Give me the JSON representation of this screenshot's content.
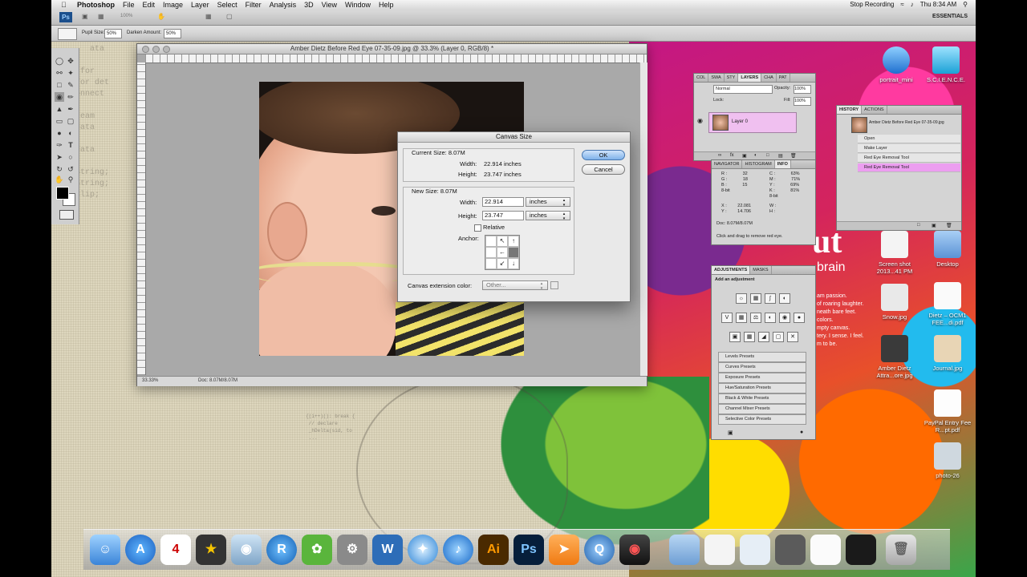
{
  "menubar": {
    "app_name": "Photoshop",
    "menus": [
      "File",
      "Edit",
      "Image",
      "Layer",
      "Select",
      "Filter",
      "Analysis",
      "3D",
      "View",
      "Window",
      "Help"
    ],
    "status_recording": "Stop Recording",
    "clock": "Thu 8:34 AM"
  },
  "appbar": {
    "ps_badge": "Ps",
    "zoom": "100%",
    "workspace": "ESSENTIALS"
  },
  "options": {
    "pupil_size_label": "Pupil Size:",
    "pupil_size_value": "50%",
    "darken_amount_label": "Darken Amount:",
    "darken_amount_value": "50%"
  },
  "document": {
    "title": "Amber Dietz Before Red Eye 07-35-09.jpg @ 33.3% (Layer 0, RGB/8) *",
    "zoom": "33.33%",
    "doc_size": "Doc: 8.07M/8.07M"
  },
  "canvas_dialog": {
    "title": "Canvas Size",
    "current_size_label": "Current Size: 8.07M",
    "current_width_label": "Width:",
    "current_width_value": "22.914 inches",
    "current_height_label": "Height:",
    "current_height_value": "23.747 inches",
    "new_size_label": "New Size: 8.07M",
    "width_label": "Width:",
    "width_value": "22.914",
    "width_unit": "inches",
    "height_label": "Height:",
    "height_value": "23.747",
    "height_unit": "inches",
    "relative_label": "Relative",
    "anchor_label": "Anchor:",
    "ext_color_label": "Canvas extension color:",
    "ext_color_value": "Other...",
    "ok_label": "OK",
    "cancel_label": "Cancel"
  },
  "layers_panel": {
    "tabs": [
      "COL",
      "SWA",
      "STY",
      "LAYERS",
      "CHA",
      "PAT"
    ],
    "blend_mode": "Normal",
    "opacity_label": "Opacity:",
    "opacity_value": "100%",
    "lock_label": "Lock:",
    "fill_label": "Fill:",
    "fill_value": "100%",
    "layer_name": "Layer 0"
  },
  "info_panel": {
    "tabs": [
      "NAVIGATOR",
      "HISTOGRAM",
      "INFO"
    ],
    "r_label": "R :",
    "r_val": "32",
    "g_label": "G :",
    "g_val": "18",
    "b_label": "B :",
    "b_val": "15",
    "bit_left": "8-bit",
    "c_label": "C :",
    "c_val": "63%",
    "m_label": "M :",
    "m_val": "71%",
    "y_label": "Y :",
    "y_val": "69%",
    "k_label": "K :",
    "k_val": "81%",
    "bit_right": "8-bit",
    "x_label": "X :",
    "x_val": "22.081",
    "yy_label": "Y :",
    "yy_val": "14.706",
    "wh_w": "W :",
    "wh_h": "H :",
    "doc": "Doc: 8.07M/8.07M",
    "hint": "Click and drag to remove red eye."
  },
  "history_panel": {
    "tabs": [
      "HISTORY",
      "ACTIONS"
    ],
    "snapshot": "Amber Dietz Before Red Eye 07-35-09.jpg",
    "steps": [
      "Open",
      "Make Layer",
      "Red Eye Removal Tool",
      "Red Eye Removal Tool"
    ]
  },
  "adjustments_panel": {
    "tabs": [
      "ADJUSTMENTS",
      "MASKS"
    ],
    "header": "Add an adjustment",
    "presets": [
      "Levels Presets",
      "Curves Presets",
      "Exposure Presets",
      "Hue/Saturation Presets",
      "Black & White Presets",
      "Channel Mixer Presets",
      "Selective Color Presets"
    ]
  },
  "desktop_icons": [
    {
      "label": "portrait_mini"
    },
    {
      "label": "S.C.I.E.N.C.E."
    },
    {
      "label": "Screen shot 2013...41 PM"
    },
    {
      "label": "Desktop"
    },
    {
      "label": "Snow.jpg"
    },
    {
      "label": "Dietz – OCM1 FEE...di.pdf"
    },
    {
      "label": "Amber Dietz Attra...ore.jpg"
    },
    {
      "label": "Journal.jpg"
    },
    {
      "label": "PayPal Entry Fee R...pt.pdf"
    },
    {
      "label": "photo-26"
    }
  ],
  "wallpaper": {
    "big_letters": "ut",
    "side_word": "brain",
    "poem": [
      "am passion.",
      "of roaring laughter.",
      "neath bare feet.",
      "colors.",
      "mpty canvas.",
      "tery. I sense. I feel.",
      "m to be."
    ]
  },
  "dock": {
    "items": [
      "Finder",
      "App Store",
      "iCal",
      "iMovie",
      "iPhoto",
      "R",
      "Growl",
      "System Preferences",
      "Word",
      "Safari",
      "iTunes",
      "Illustrator",
      "Photoshop",
      "Lasso",
      "QuickTime",
      "Photo Booth",
      "Folder",
      "Stack",
      "Stack",
      "Stack",
      "Stack",
      "Stack",
      "Trash"
    ],
    "ical_day": "4",
    "ai_label": "Ai",
    "ps_label": "Ps"
  },
  "colors": {
    "menubar_bg": "#e6e6e6",
    "selected_layer": "#f0c0f0",
    "history_selected": "#ec9ef0",
    "ok_button": "#7fb2ea"
  }
}
